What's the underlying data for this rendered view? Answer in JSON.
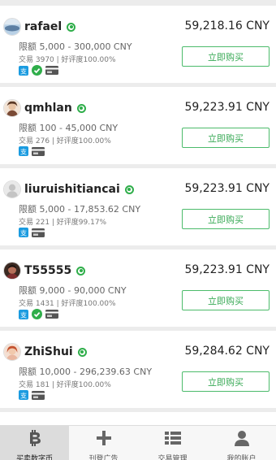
{
  "offers": [
    {
      "name": "rafael",
      "price": "59,218.16 CNY",
      "limit": "限额 5,000 - 300,000 CNY",
      "stats": "交易 3970 | 好评度100.00%",
      "payments": [
        "alipay-icon",
        "verified-icon",
        "bank-card-icon"
      ],
      "buy_label": "立即购买"
    },
    {
      "name": "qmhlan",
      "price": "59,223.91 CNY",
      "limit": "限额 100 - 45,000 CNY",
      "stats": "交易 276 | 好评度100.00%",
      "payments": [
        "alipay-icon",
        "bank-card-icon"
      ],
      "buy_label": "立即购买"
    },
    {
      "name": "liuruishitiancai",
      "price": "59,223.91 CNY",
      "limit": "限额 5,000 - 17,853.62 CNY",
      "stats": "交易 221 | 好评度99.17%",
      "payments": [
        "alipay-icon",
        "bank-card-icon"
      ],
      "buy_label": "立即购买"
    },
    {
      "name": "T55555",
      "price": "59,223.91 CNY",
      "limit": "限额 9,000 - 90,000 CNY",
      "stats": "交易 1431 | 好评度100.00%",
      "payments": [
        "alipay-icon",
        "verified-icon",
        "bank-card-icon"
      ],
      "buy_label": "立即购买"
    },
    {
      "name": "ZhiShui",
      "price": "59,284.62 CNY",
      "limit": "限额 10,000 - 296,239.63 CNY",
      "stats": "交易 181 | 好评度100.00%",
      "payments": [
        "alipay-icon",
        "bank-card-icon"
      ],
      "buy_label": "立即购买"
    }
  ],
  "tabs": [
    {
      "label": "买卖数字币",
      "icon": "bitcoin-icon",
      "active": true
    },
    {
      "label": "刊登广告",
      "icon": "plus-icon",
      "active": false
    },
    {
      "label": "交易管理",
      "icon": "list-icon",
      "active": false
    },
    {
      "label": "我的账户",
      "icon": "user-icon",
      "active": false
    }
  ],
  "colors": {
    "accent": "#3aaa57",
    "online": "#2fae4a",
    "alipay": "#1a9be0"
  }
}
